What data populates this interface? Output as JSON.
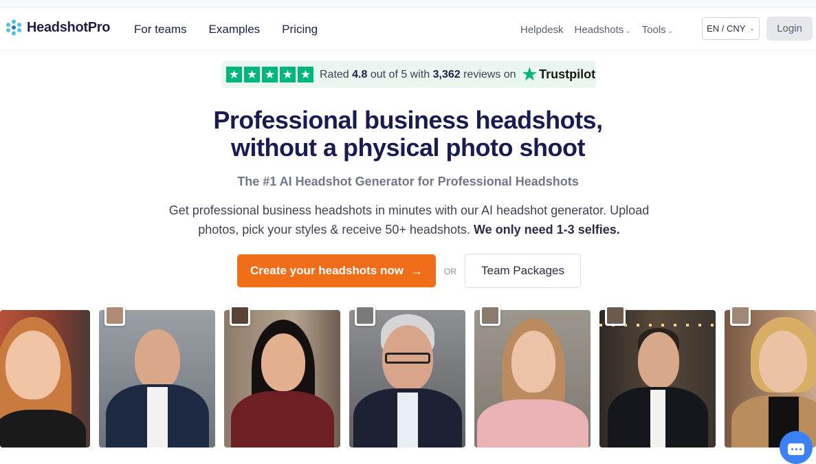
{
  "brand": {
    "name": "HeadshotPro",
    "accent": "#f06d1a",
    "nav_color": "#1c1f4a"
  },
  "nav": {
    "main": [
      "For teams",
      "Examples",
      "Pricing"
    ],
    "secondary": [
      {
        "label": "Helpdesk"
      },
      {
        "label": "Headshots",
        "dropdown": true
      },
      {
        "label": "Tools",
        "dropdown": true
      }
    ],
    "language": "EN / CNY",
    "login": "Login"
  },
  "trustpilot": {
    "prefix": "Rated",
    "rating": "4.8",
    "middle": "out of 5 with",
    "reviews": "3,362",
    "suffix": "reviews on",
    "brand": "Trustpilot",
    "stars": 5
  },
  "hero": {
    "title_line1": "Professional business headshots,",
    "title_line2": "without a physical photo shoot",
    "subtitle": "The #1 AI Headshot Generator for Professional Headshots",
    "desc_line1": "Get professional business headshots in minutes with our AI headshot generator. Upload",
    "desc_line2": "photos, pick your styles & receive 50+ headshots.",
    "desc_bold": "We only need 1-3 selfies.",
    "cta_label": "Create your headshots now",
    "or_label": "OR",
    "secondary_label": "Team Packages"
  },
  "gallery": [
    {
      "name": "woman-redhair-portrait"
    },
    {
      "name": "man-bald-suit-portrait"
    },
    {
      "name": "woman-darkhair-portrait"
    },
    {
      "name": "man-glasses-suit-portrait"
    },
    {
      "name": "woman-blonde-portrait"
    },
    {
      "name": "man-suit-street-portrait"
    },
    {
      "name": "woman-curly-blonde-portrait"
    }
  ]
}
